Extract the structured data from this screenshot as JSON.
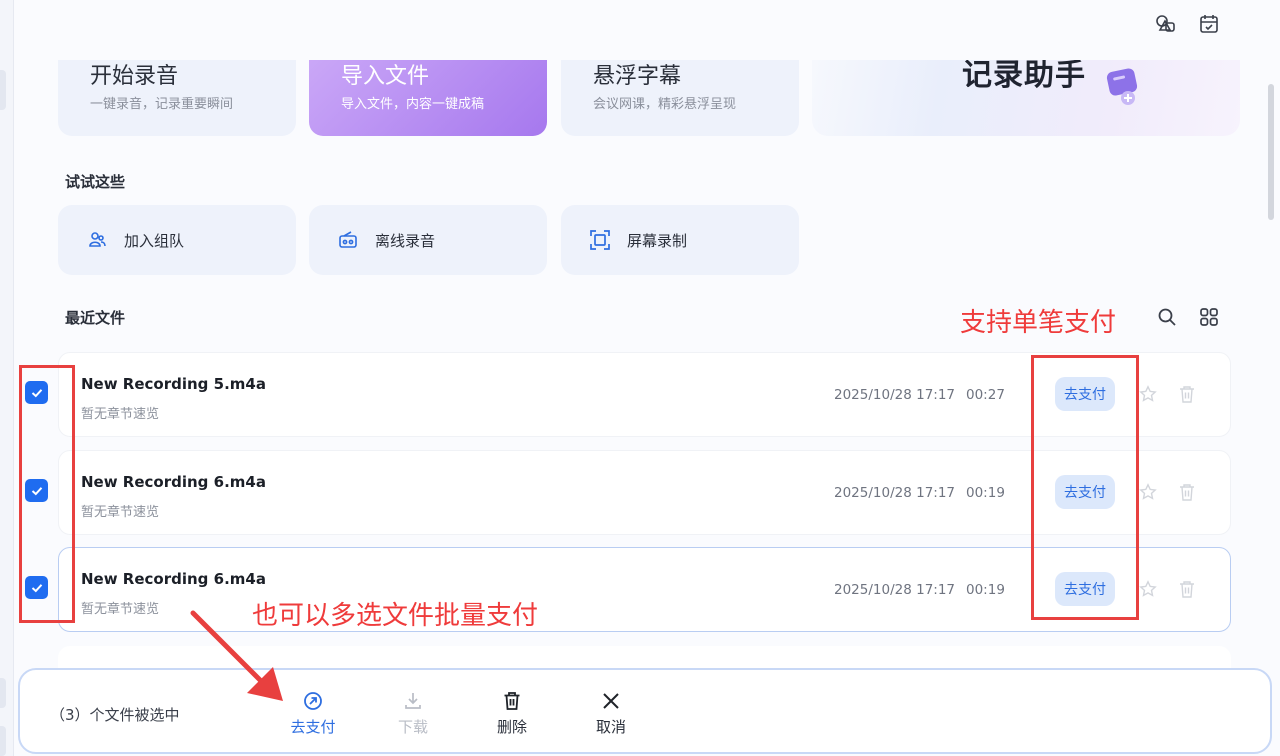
{
  "cards": [
    {
      "title": "开始录音",
      "sub": "一键录音，记录重要瞬间"
    },
    {
      "title": "导入文件",
      "sub": "导入文件，内容一键成稿"
    },
    {
      "title": "悬浮字幕",
      "sub": "会议网课，精彩悬浮呈现"
    }
  ],
  "promo": {
    "title": "记录助手"
  },
  "try_section": {
    "title": "试试这些"
  },
  "quick_actions": [
    {
      "label": "加入组队",
      "icon": "team-icon"
    },
    {
      "label": "离线录音",
      "icon": "radio-icon"
    },
    {
      "label": "屏幕录制",
      "icon": "screen-record-icon"
    }
  ],
  "recent": {
    "title": "最近文件"
  },
  "annotations": {
    "single_pay": "支持单笔支付",
    "batch_pay": "也可以多选文件批量支付"
  },
  "files": [
    {
      "name": "New Recording 5.m4a",
      "sub": "暂无章节速览",
      "date": "2025/10/28 17:17",
      "duration": "00:27",
      "pay": "去支付",
      "checked": true
    },
    {
      "name": "New Recording 6.m4a",
      "sub": "暂无章节速览",
      "date": "2025/10/28 17:17",
      "duration": "00:19",
      "pay": "去支付",
      "checked": true
    },
    {
      "name": "New Recording 6.m4a",
      "sub": "暂无章节速览",
      "date": "2025/10/28 17:17",
      "duration": "00:19",
      "pay": "去支付",
      "checked": true
    }
  ],
  "bottom_bar": {
    "count_text": "（3）个文件被选中",
    "pay": "去支付",
    "download": "下载",
    "delete": "删除",
    "cancel": "取消"
  },
  "colors": {
    "accent": "#1f6cf0",
    "annotation": "#e8403f",
    "pay_bg": "#dce8fb"
  }
}
